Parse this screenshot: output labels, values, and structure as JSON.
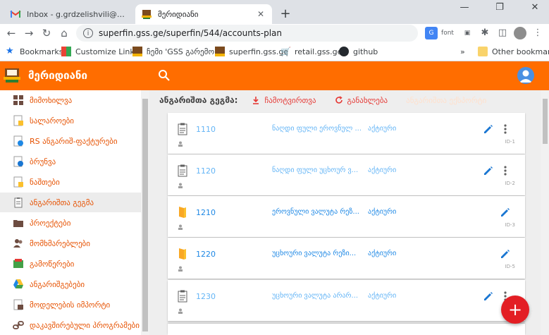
{
  "browser": {
    "tabs": [
      {
        "title": "Inbox - g.grdzelishvili@gss.ge - G",
        "active": false
      },
      {
        "title": "მერიდიანი",
        "active": true
      }
    ],
    "url": "superfin.gss.ge/superfin/544/accounts-plan",
    "ext_font_label": "font",
    "bookmarks": [
      {
        "label": "Bookmarks",
        "icon": "star-icon"
      },
      {
        "label": "Customize Links",
        "icon": "grid-icon"
      },
      {
        "label": "ჩემი 'GSS გარემო'",
        "icon": "folder-icon"
      },
      {
        "label": "superfin.gss.ge",
        "icon": "app-icon"
      },
      {
        "label": "retail.gss.ge",
        "icon": "cart-icon"
      },
      {
        "label": "github",
        "icon": "github-icon"
      }
    ],
    "bookmarks_overflow": "»",
    "other_bookmarks": "Other bookmarks"
  },
  "app": {
    "title": "მერიდიანი",
    "accent": "#ff6d00"
  },
  "sidebar": {
    "items": [
      {
        "label": "მიმოხილვა",
        "icon": "dashboard-icon"
      },
      {
        "label": "სალაროები",
        "icon": "cash-document-icon"
      },
      {
        "label": "RS ანგარიშ-ფაქტურები",
        "icon": "rs-invoice-icon"
      },
      {
        "label": "ბრუნვა",
        "icon": "turnover-document-icon"
      },
      {
        "label": "ნაშთები",
        "icon": "balances-document-icon"
      },
      {
        "label": "ანგარიშთა გეგმა",
        "icon": "clipboard-icon",
        "active": true
      },
      {
        "label": "პროექტები",
        "icon": "folder-icon"
      },
      {
        "label": "მომხმარებლები",
        "icon": "users-icon"
      },
      {
        "label": "გამოწერები",
        "icon": "subscriptions-icon"
      },
      {
        "label": "ანგარიშგებები",
        "icon": "drive-icon"
      },
      {
        "label": "მოდელების იმპორტი",
        "icon": "import-icon"
      },
      {
        "label": "დაკავშირებული პროგრამები",
        "icon": "link-icon"
      }
    ]
  },
  "toolbar": {
    "title": "ანგარიშთა გეგმა:",
    "download_label": "ჩამოტვირთვა",
    "refresh_label": "განახლება",
    "extra_label": "ანგარიშთა ექსპორტი"
  },
  "accounts": [
    {
      "code": "1110",
      "name": "ნაღდი ფული ეროვნულ ...",
      "status": "აქტიური",
      "id": "ID-1",
      "icon": "clipboard-icon",
      "dim": false,
      "more": true
    },
    {
      "code": "1120",
      "name": "ნაღდი ფული უცხოურ ვ...",
      "status": "აქტიური",
      "id": "ID-2",
      "icon": "clipboard-icon",
      "dim": true,
      "more": true
    },
    {
      "code": "1210",
      "name": "ეროვნული ვალუტა რეზ...",
      "status": "აქტიური",
      "id": "ID-3",
      "icon": "folder-icon",
      "dim": false,
      "more": false
    },
    {
      "code": "1220",
      "name": "უცხოური ვალუტა რეზი...",
      "status": "აქტიური",
      "id": "ID-5",
      "icon": "folder-icon",
      "dim": false,
      "more": false
    },
    {
      "code": "1230",
      "name": "უცხოური ვალუტა არარ...",
      "status": "აქტიური",
      "id": "",
      "icon": "clipboard-icon",
      "dim": true,
      "more": true
    }
  ],
  "fab_label": "+"
}
